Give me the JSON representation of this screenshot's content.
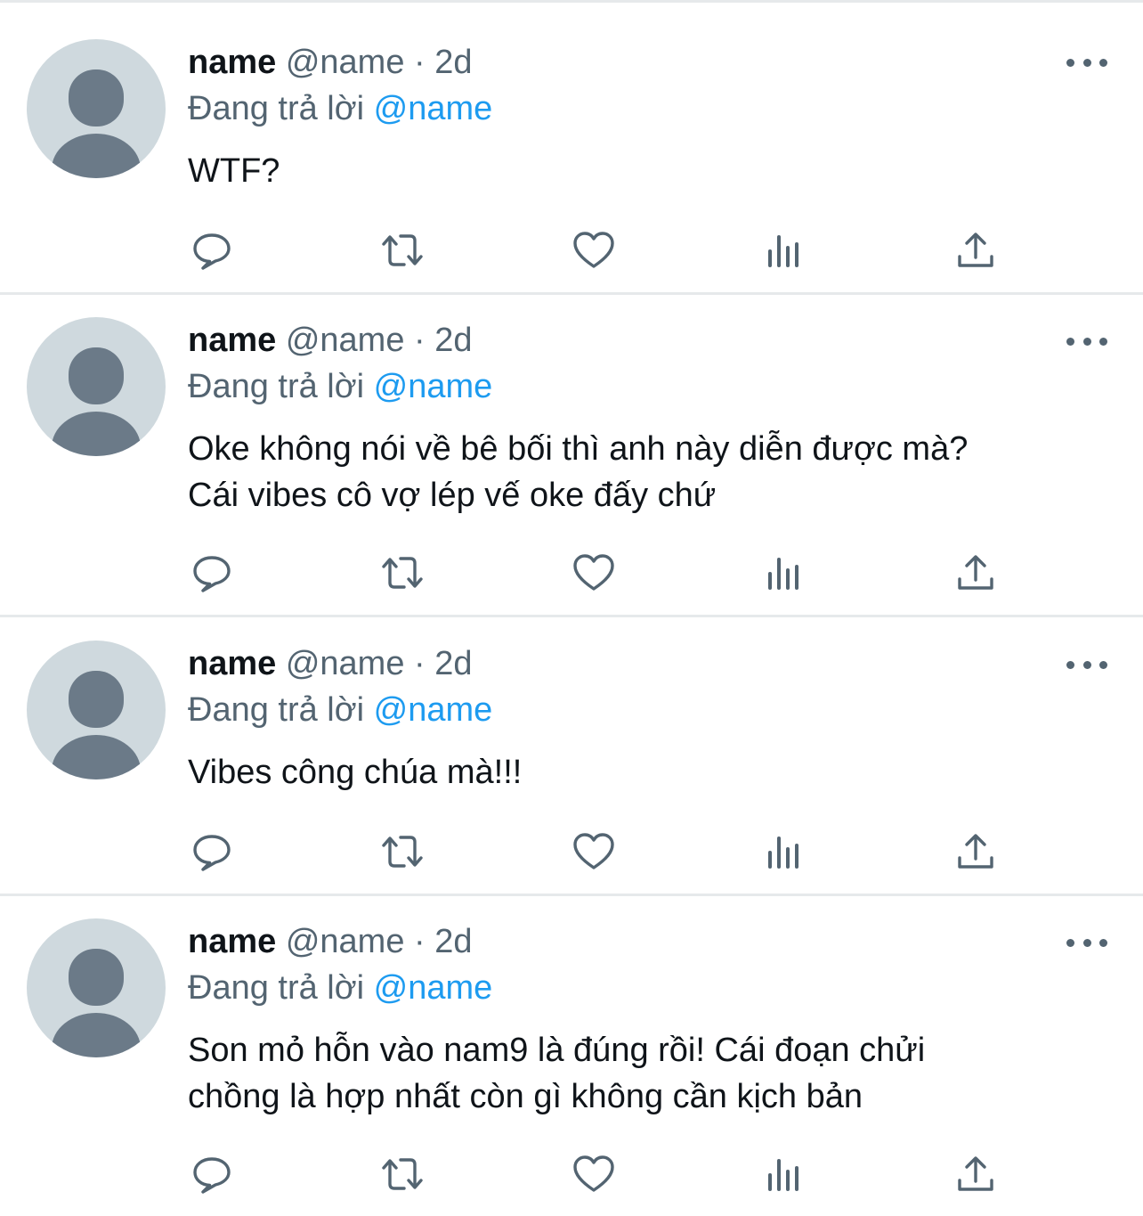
{
  "tweets": [
    {
      "name": "name",
      "handle": "@name",
      "separator": "·",
      "time": "2d",
      "replying_prefix": "Đang trả lời",
      "replying_to": "@name",
      "text": "WTF?"
    },
    {
      "name": "name",
      "handle": "@name",
      "separator": "·",
      "time": "2d",
      "replying_prefix": "Đang trả lời",
      "replying_to": "@name",
      "text": "Oke không nói về bê bối thì anh này diễn được mà?\nCái vibes cô vợ lép vế oke đấy chứ"
    },
    {
      "name": "name",
      "handle": "@name",
      "separator": "·",
      "time": "2d",
      "replying_prefix": "Đang trả lời",
      "replying_to": "@name",
      "text": "Vibes công chúa mà!!!"
    },
    {
      "name": "name",
      "handle": "@name",
      "separator": "·",
      "time": "2d",
      "replying_prefix": "Đang trả lời",
      "replying_to": "@name",
      "text": "Son mỏ hỗn vào nam9 là đúng rồi! Cái đoạn chửi\nchồng là hợp nhất còn gì không cần kịch bản"
    }
  ],
  "action_icons": [
    "reply-icon",
    "retweet-icon",
    "like-icon",
    "views-icon",
    "share-icon"
  ],
  "more_icon": "more-options-icon",
  "colors": {
    "text": "#0f1419",
    "secondary": "#536471",
    "link": "#1d9bf0",
    "divider": "#e6e9eb",
    "avatar_bg": "#cfd9de",
    "avatar_fg": "#6b7a88"
  }
}
